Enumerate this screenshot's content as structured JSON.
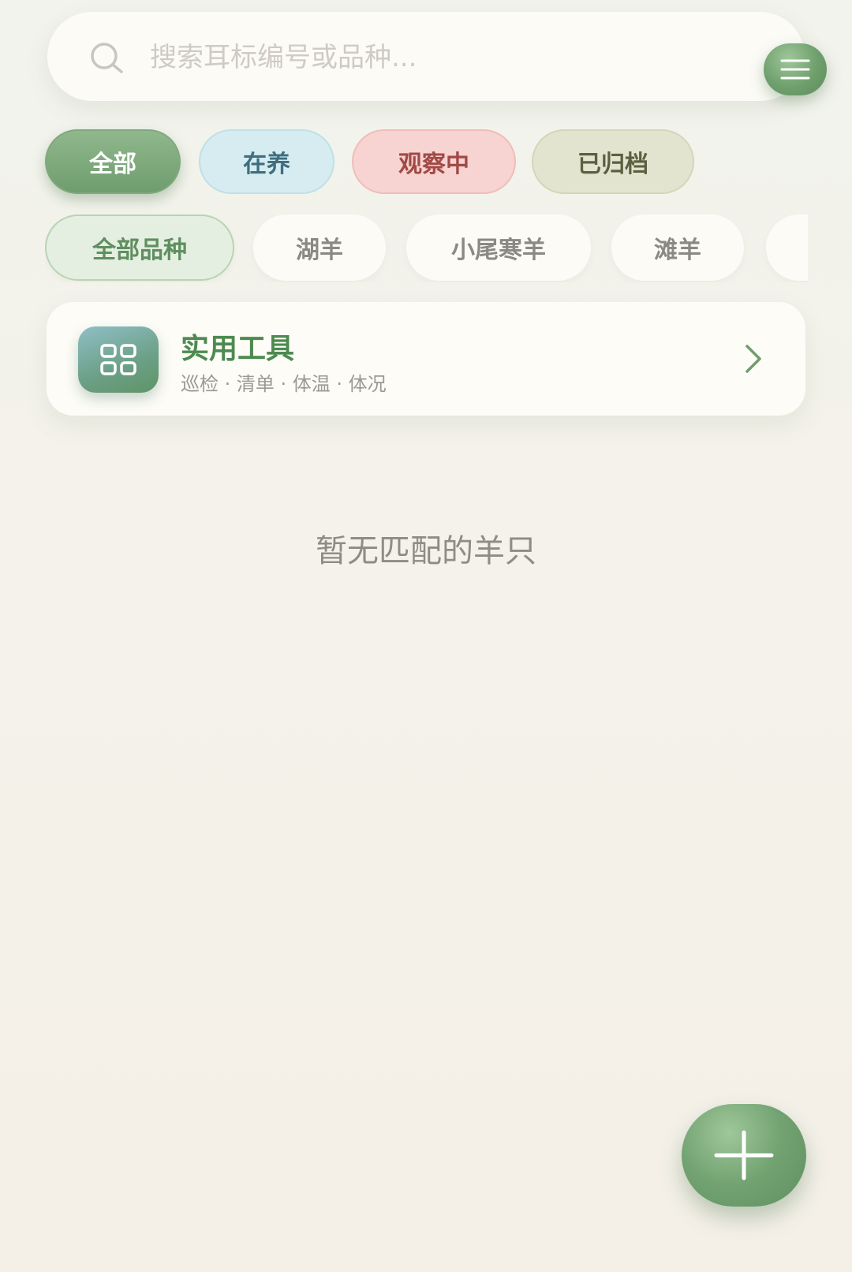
{
  "search": {
    "placeholder": "搜索耳标编号或品种...",
    "value": ""
  },
  "status_filters": [
    {
      "label": "全部",
      "selected": true
    },
    {
      "label": "在养",
      "selected": false
    },
    {
      "label": "观察中",
      "selected": false
    },
    {
      "label": "已归档",
      "selected": false
    }
  ],
  "breed_filters": [
    {
      "label": "全部品种",
      "selected": true
    },
    {
      "label": "湖羊",
      "selected": false
    },
    {
      "label": "小尾寒羊",
      "selected": false
    },
    {
      "label": "滩羊",
      "selected": false
    },
    {
      "label": "",
      "selected": false
    }
  ],
  "tools_card": {
    "title": "实用工具",
    "subtitle": "巡检 · 清单 · 体温 · 体况"
  },
  "empty_state": {
    "message": "暂无匹配的羊只"
  },
  "icons": {
    "search": "search-icon",
    "menu": "menu-icon",
    "tools": "grid-icon",
    "chevron": "chevron-right-icon",
    "fab": "plus-icon"
  },
  "colors": {
    "accent": "#6f9d6e",
    "active_chip": "#d6ecf0",
    "watch_chip": "#f7d3d1",
    "archived_chip": "#e3e4cf",
    "background": "#f4f2ea"
  }
}
